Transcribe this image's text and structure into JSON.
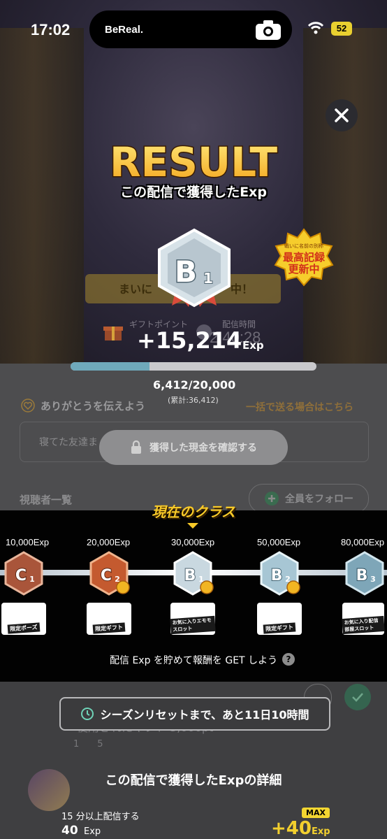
{
  "status_bar": {
    "time": "17:02",
    "battery": "52",
    "island_app": "BeReal."
  },
  "result": {
    "title": "RESULT",
    "subtitle": "この配信で獲得したExp",
    "rank": "B",
    "rank_sub": "1",
    "record_badge": [
      "戦いに名前の別称",
      "最高記録",
      "更新中"
    ]
  },
  "stream": {
    "banner": "まいに　　　　　　　中！",
    "gift_label": "ギフトポイント",
    "time_label": "配信時間",
    "time_value": "2:40:28"
  },
  "exp": {
    "gain": "+15,214",
    "unit": "Exp",
    "current": "6,412/20,000",
    "total": "(累計:36,412)",
    "progress": 0.3206
  },
  "thanks": {
    "label": "ありがとうを伝えよう",
    "bulk_link": "一括で送る場合はこちら",
    "message_placeholder": "寝てた友達ま"
  },
  "confirm_button": "獲得した現金を確認する",
  "viewers": {
    "label": "視聴者一覧",
    "follow_all": "全員をフォロー"
  },
  "class_track": {
    "title": "現在のクラス",
    "tiers": [
      {
        "exp": "10,000Exp",
        "rank": "C",
        "sub": "1",
        "reward": "限定ポーズ"
      },
      {
        "exp": "20,000Exp",
        "rank": "C",
        "sub": "2",
        "reward": "限定ギフト"
      },
      {
        "exp": "30,000Exp",
        "rank": "B",
        "sub": "1",
        "reward": "お気に入りエモモスロット"
      },
      {
        "exp": "50,000Exp",
        "rank": "B",
        "sub": "2",
        "reward": "限定ギフト"
      },
      {
        "exp": "80,000Exp",
        "rank": "B",
        "sub": "3",
        "reward": "お気に入り配信部屋スロット"
      }
    ],
    "hint": "配信 Exp を貯めて報酬を GET しよう",
    "help": "?"
  },
  "season": {
    "text": "シーズンリセットまで、あと11日10時間"
  },
  "background_rows": {
    "row1": "使用されたギフト 3,000pt",
    "row2": "1　　5"
  },
  "detail": {
    "title": "この配信で獲得したExpの詳細",
    "row_label": "15 分以上配信する",
    "row_value": "40",
    "row_unit": "Exp",
    "max_badge": "MAX",
    "row_gain": "+40",
    "row_gain_unit": "Exp"
  },
  "colors": {
    "accent_gold": "#f7c928",
    "progress_fill": "#6fa9bb",
    "c_rank": "#b5532e",
    "b_rank": "#7ea6b8"
  }
}
